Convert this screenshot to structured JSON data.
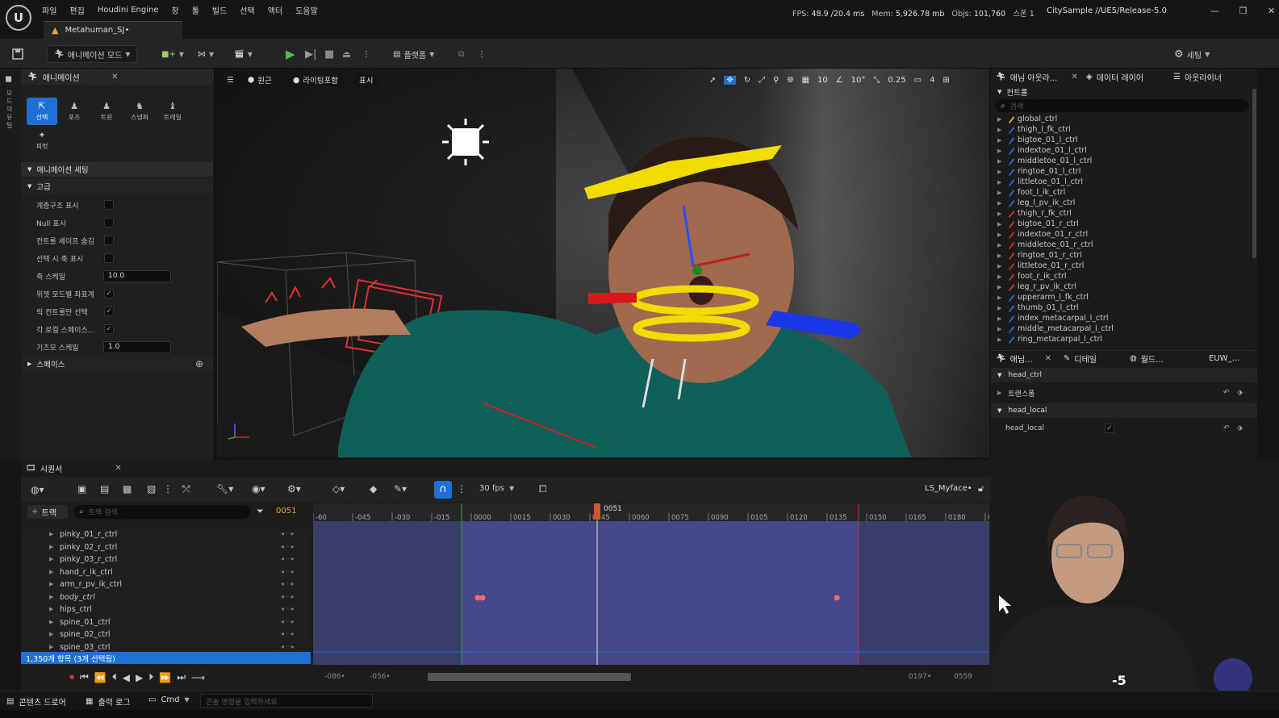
{
  "window": {
    "menu": [
      "파일",
      "편집",
      "Houdini Engine",
      "창",
      "툴",
      "빌드",
      "선택",
      "액터",
      "도움말"
    ],
    "perf": {
      "fps_label": "FPS:",
      "fps": "48.9",
      "ms": "/20.4 ms",
      "mem_label": "Mem:",
      "mem": "5,926.78 mb",
      "objs_label": "Objs:",
      "objs": "101,760",
      "extra": "스폰 1"
    },
    "project_path": "CitySample //UE5/Release-5.0",
    "doc_tab": "Metahuman_SJ•",
    "controls": [
      "—",
      "❐",
      "✕"
    ]
  },
  "toolbar": {
    "mode_label": "애니메이션 모드",
    "platform_label": "플랫폼",
    "settings_label": "세팅"
  },
  "left_strip": {
    "label": "모드의 유틸"
  },
  "anim_panel": {
    "tab": "애니메이션",
    "modes": [
      {
        "label": "선택",
        "selected": true
      },
      {
        "label": "포즈",
        "selected": false
      },
      {
        "label": "트윈",
        "selected": false
      },
      {
        "label": "스냅퍼",
        "selected": false
      },
      {
        "label": "트레일",
        "selected": false
      },
      {
        "label": "피벗",
        "selected": false
      }
    ],
    "section": "애니메이션 세팅",
    "subsection": "고급",
    "props": [
      {
        "label": "계층구조 표시",
        "type": "check",
        "checked": false
      },
      {
        "label": "Null 표시",
        "type": "check",
        "checked": false
      },
      {
        "label": "컨트롤 셰이프 숨김",
        "type": "check",
        "checked": false
      },
      {
        "label": "선택 시 축 표시",
        "type": "check",
        "checked": false
      },
      {
        "label": "축 스케일",
        "type": "num",
        "value": "10.0"
      },
      {
        "label": "위젯 모드별 좌표계",
        "type": "check",
        "checked": true
      },
      {
        "label": "릭 컨트롤만 선택",
        "type": "check",
        "checked": true
      },
      {
        "label": "각 로컬 스페이스...",
        "type": "check",
        "checked": true
      },
      {
        "label": "기즈모 스케일",
        "type": "num",
        "value": "1.0"
      }
    ],
    "space_section": "스페이스"
  },
  "viewport": {
    "view_label": "원근",
    "lighting_label": "라이팅포함",
    "show_label": "표시",
    "grid_snap": "10",
    "rot_snap": "10°",
    "scale_snap": "0.25",
    "camera_speed": "4"
  },
  "outliner": {
    "tabs": [
      "애님 아웃라...",
      "데이터 레이어",
      "아웃라이너"
    ],
    "section": "컨트롤",
    "search_placeholder": "검색",
    "items": [
      {
        "name": "global_ctrl",
        "color": "#e2c02a"
      },
      {
        "name": "thigh_l_fk_ctrl",
        "color": "#2c6ae8"
      },
      {
        "name": "bigtoe_01_l_ctrl",
        "color": "#2c6ae8"
      },
      {
        "name": "indextoe_01_l_ctrl",
        "color": "#2c6ae8"
      },
      {
        "name": "middletoe_01_l_ctrl",
        "color": "#2c6ae8"
      },
      {
        "name": "ringtoe_01_l_ctrl",
        "color": "#2c6ae8"
      },
      {
        "name": "littletoe_01_l_ctrl",
        "color": "#2c6ae8"
      },
      {
        "name": "foot_l_ik_ctrl",
        "color": "#2c6ae8"
      },
      {
        "name": "leg_l_pv_ik_ctrl",
        "color": "#2c6ae8"
      },
      {
        "name": "thigh_r_fk_ctrl",
        "color": "#d83030"
      },
      {
        "name": "bigtoe_01_r_ctrl",
        "color": "#d83030"
      },
      {
        "name": "indextoe_01_r_ctrl",
        "color": "#d83030"
      },
      {
        "name": "middletoe_01_r_ctrl",
        "color": "#d83030"
      },
      {
        "name": "ringtoe_01_r_ctrl",
        "color": "#d83030"
      },
      {
        "name": "littletoe_01_r_ctrl",
        "color": "#d83030"
      },
      {
        "name": "foot_r_ik_ctrl",
        "color": "#d83030"
      },
      {
        "name": "leg_r_pv_ik_ctrl",
        "color": "#d83030"
      },
      {
        "name": "upperarm_l_fk_ctrl",
        "color": "#2c6ae8"
      },
      {
        "name": "thumb_01_l_ctrl",
        "color": "#2c6ae8"
      },
      {
        "name": "index_metacarpal_l_ctrl",
        "color": "#2c6ae8"
      },
      {
        "name": "middle_metacarpal_l_ctrl",
        "color": "#2c6ae8"
      },
      {
        "name": "ring_metacarpal_l_ctrl",
        "color": "#2c6ae8"
      }
    ]
  },
  "details": {
    "tabs": [
      "애님...",
      "디테일",
      "월드...",
      "EUW_..."
    ],
    "header": "head_ctrl",
    "transform_label": "트랜스폼",
    "local_section": "head_local",
    "local_prop": "head_local",
    "local_checked": true
  },
  "sequencer": {
    "tab": "시퀀서",
    "fps_label": "30 fps",
    "sequence_name": "LS_Myface•",
    "add_track": "트랙",
    "search_placeholder": "트랙 검색",
    "current_frame": "0051",
    "ruler_labels": [
      "-60",
      "-045",
      "-030",
      "-015",
      "0000",
      "0015",
      "0030",
      "0045",
      "0060",
      "0075",
      "0090",
      "0105",
      "0120",
      "0135",
      "0150",
      "0165",
      "0180",
      "0"
    ],
    "playhead_label": "0051",
    "tracks": [
      "pinky_01_r_ctrl",
      "pinky_02_r_ctrl",
      "pinky_03_r_ctrl",
      "hand_r_ik_ctrl",
      "arm_r_pv_ik_ctrl",
      "body_ctrl",
      "hips_ctrl",
      "spine_01_ctrl",
      "spine_02_ctrl",
      "spine_03_ctrl"
    ],
    "status": "1,350개 항목 (3개 선택됨)",
    "range_start": "-086•",
    "view_start": "-056•",
    "view_end": "0197•",
    "range_end": "0559"
  },
  "statusbar": {
    "content_drawer": "콘텐츠 드로어",
    "output_log": "출력 로그",
    "cmd": "Cmd",
    "console_placeholder": "콘솔 명령을 입력하세요"
  },
  "overlay": {
    "badge": "-5"
  }
}
